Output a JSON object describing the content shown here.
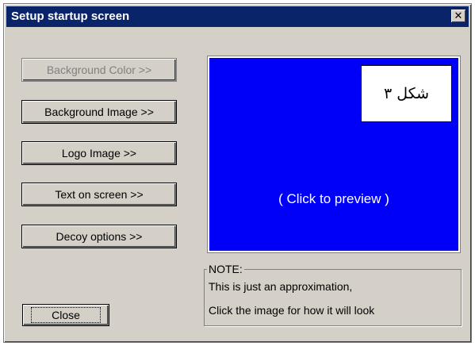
{
  "window": {
    "title": "Setup startup screen",
    "close_glyph": "✕"
  },
  "buttons": [
    {
      "label": "Background Color >>",
      "enabled": false
    },
    {
      "label": "Background Image >>",
      "enabled": true
    },
    {
      "label": "Logo Image >>",
      "enabled": true
    },
    {
      "label": "Text on screen >>",
      "enabled": true
    },
    {
      "label": "Decoy options >>",
      "enabled": true
    }
  ],
  "preview": {
    "label": "( Click to preview )",
    "background_color": "#0000f8",
    "figure_label": "شکل ۳"
  },
  "note": {
    "legend": "NOTE:",
    "line1": "This is just an approximation,",
    "line2": "Click the image for how it will look"
  },
  "close_button": {
    "label": "Close"
  }
}
